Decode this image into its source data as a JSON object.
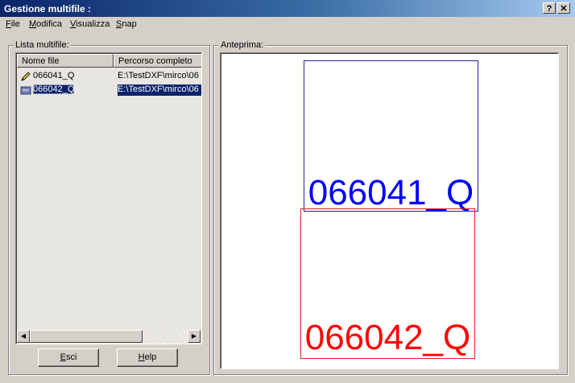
{
  "window": {
    "title": "Gestione multifile :",
    "help_btn": "?",
    "close_btn": "✕"
  },
  "menu": {
    "items": [
      {
        "mnemonic": "F",
        "rest": "ile"
      },
      {
        "mnemonic": "M",
        "rest": "odifica"
      },
      {
        "mnemonic": "V",
        "rest": "isualizza"
      },
      {
        "mnemonic": "S",
        "rest": "nap"
      }
    ]
  },
  "list": {
    "group_label": "Lista multifile:",
    "columns": [
      "Nome file",
      "Percorso completo"
    ],
    "rows": [
      {
        "icon": "pencil-icon",
        "name": "066041_Q",
        "path": "E:\\TestDXF\\mirco\\06",
        "selected": false
      },
      {
        "icon": "layer-icon",
        "name": "066042_Q",
        "path": "E:\\TestDXF\\mirco\\06",
        "selected": true
      }
    ],
    "scroll_left": "◀",
    "scroll_right": "▶"
  },
  "buttons": {
    "esci_mn": "E",
    "esci_rest": "sci",
    "help_mn": "H",
    "help_rest": "elp"
  },
  "preview": {
    "group_label": "Anteprima:",
    "sheets": [
      {
        "label": "066041_Q",
        "color": "#0000ff"
      },
      {
        "label": "066042_Q",
        "color": "#ff0000"
      }
    ]
  },
  "colors": {
    "titlebar": "#0a246a",
    "selection": "#0a246a",
    "face": "#d4d0c8"
  }
}
